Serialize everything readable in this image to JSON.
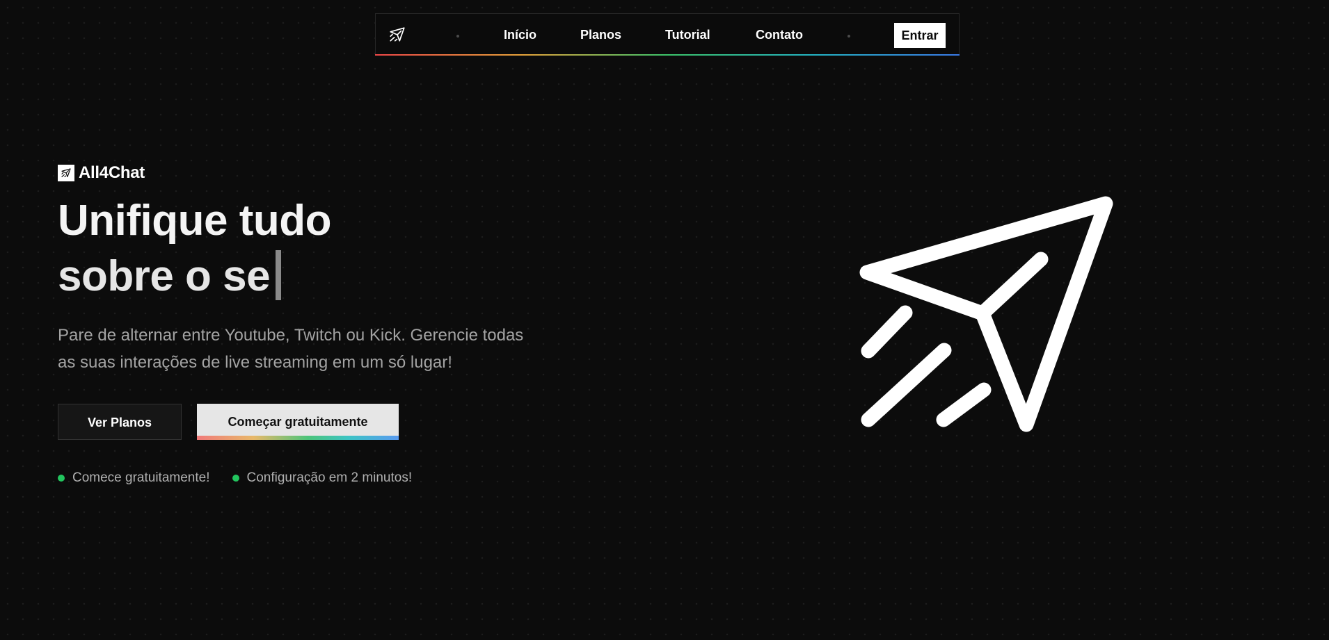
{
  "nav": {
    "logo_icon": "paper-plane-icon",
    "links": [
      {
        "label": "Início"
      },
      {
        "label": "Planos"
      },
      {
        "label": "Tutorial"
      },
      {
        "label": "Contato"
      }
    ],
    "login_label": "Entrar"
  },
  "hero": {
    "brand_icon": "paper-plane-icon",
    "brand_name": "All4Chat",
    "headline_line1": "Unifique tudo",
    "headline_line2": "sobre o se",
    "subtitle": "Pare de alternar entre Youtube, Twitch ou Kick. Gerencie todas as suas interações de live streaming em um só lugar!",
    "cta_secondary": "Ver Planos",
    "cta_primary": "Começar gratuitamente",
    "features": [
      {
        "text": "Comece gratuitamente!"
      },
      {
        "text": "Configuração em 2 minutos!"
      }
    ],
    "illustration_icon": "paper-plane-icon"
  },
  "colors": {
    "background": "#0c0c0c",
    "accent_green": "#22c55e",
    "text_muted": "#a3a3a3"
  }
}
